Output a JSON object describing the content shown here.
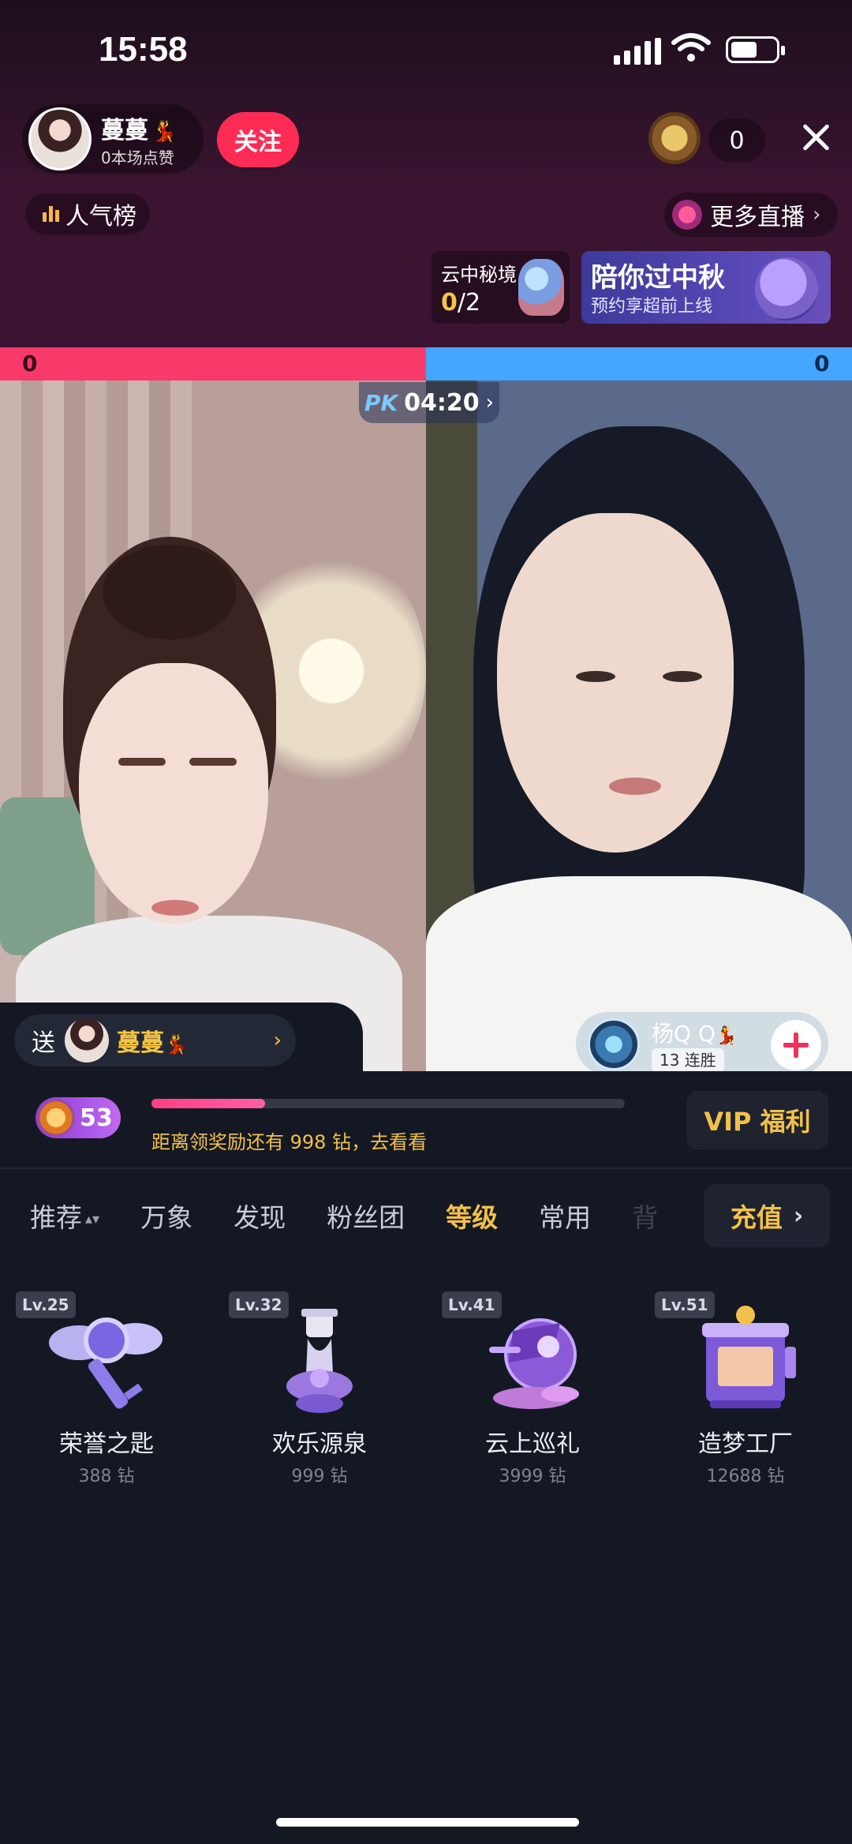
{
  "status_bar": {
    "time": "15:58"
  },
  "colors": {
    "accent_pink": "#fe2c55",
    "pk_red": "#f73a6a",
    "pk_blue": "#45a6ff",
    "gold": "#f2c14a",
    "panel_bg": "#141823"
  },
  "host": {
    "name": "蔓蔓",
    "name_emoji": "💃",
    "likes": "0本场点赞",
    "follow_label": "关注"
  },
  "viewers": {
    "count": "0"
  },
  "rank": {
    "label": "人气榜",
    "icon": "bar-chart-icon"
  },
  "more_live": {
    "label": "更多直播",
    "chevron": "›"
  },
  "event_card": {
    "title": "云中秘境",
    "progress_current": "0",
    "progress_total": "/2"
  },
  "banner": {
    "title": "陪你过中秋",
    "subtitle": "预约享超前上线"
  },
  "pk": {
    "left_score": "0",
    "right_score": "0",
    "logo_p": "P",
    "logo_k": "K",
    "timer": "04:20",
    "chevron": "›"
  },
  "send": {
    "label": "送",
    "target_name": "蔓蔓",
    "target_emoji": "💃",
    "chevron": "›"
  },
  "opponent": {
    "name": "杨Q Q",
    "name_emoji": "💃",
    "streak": "13 连胜"
  },
  "level": {
    "value": "53",
    "progress_fraction": 0.24,
    "hint": "距离领奖励还有 998 钻，去看看"
  },
  "vip_label": "VIP 福利",
  "tabs": [
    {
      "label": "推荐",
      "active": false,
      "sort_icon": "▴▾"
    },
    {
      "label": "万象",
      "active": false
    },
    {
      "label": "发现",
      "active": false
    },
    {
      "label": "粉丝团",
      "active": false
    },
    {
      "label": "等级",
      "active": true
    },
    {
      "label": "常用",
      "active": false
    },
    {
      "label": "背",
      "active": false
    }
  ],
  "recharge": {
    "label": "充值",
    "chevron": "›"
  },
  "gifts": [
    {
      "level": "Lv.25",
      "name": "荣誉之匙",
      "price": "388 钻",
      "icon": "winged-key-icon"
    },
    {
      "level": "Lv.32",
      "name": "欢乐源泉",
      "price": "999 钻",
      "icon": "fountain-icon"
    },
    {
      "level": "Lv.41",
      "name": "云上巡礼",
      "price": "3999 钻",
      "icon": "airship-icon"
    },
    {
      "level": "Lv.51",
      "name": "造梦工厂",
      "price": "12688 钻",
      "icon": "dream-factory-icon"
    }
  ]
}
